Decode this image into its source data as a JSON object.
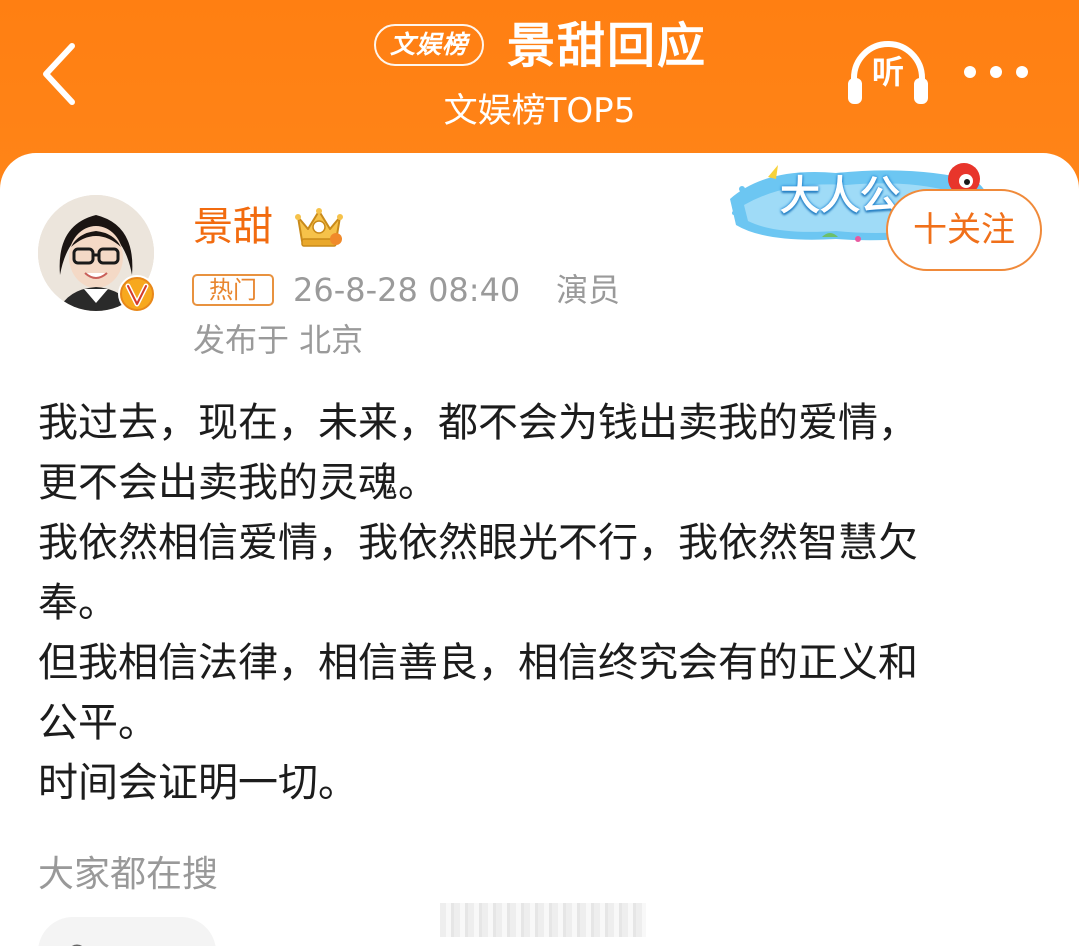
{
  "header": {
    "brand_badge": "文娱榜",
    "title": "景甜回应",
    "subtitle": "文娱榜TOP5",
    "listen_label": "听"
  },
  "post": {
    "author": {
      "name": "景甜"
    },
    "hot_tag": "热门",
    "time": "26-8-28 08:40",
    "role": "演员",
    "location": "发布于 北京",
    "banner_text": "大人公",
    "follow_label": "十关注",
    "body_lines": [
      "我过去，现在，未来，都不会为钱出卖我的爱情，",
      "更不会出卖我的灵魂。",
      "我依然相信爱情，我依然眼光不行，我依然智慧欠",
      "奉。",
      "但我相信法律，相信善良，相信终究会有的正义和",
      "公平。",
      "时间会证明一切。"
    ]
  },
  "search_section": {
    "heading": "大家都在搜"
  },
  "colors": {
    "header_orange": "#ff8a1c",
    "username_orange": "#f26b0f",
    "follow_orange": "#f0701a",
    "meta_gray": "#9a9a9a",
    "body_text": "#1c1c1c"
  },
  "icons": {
    "back": "chevron-left-icon",
    "listen": "headphones-icon",
    "more": "more-dots-icon",
    "crown": "crown-icon",
    "verified": "verified-v-icon"
  }
}
